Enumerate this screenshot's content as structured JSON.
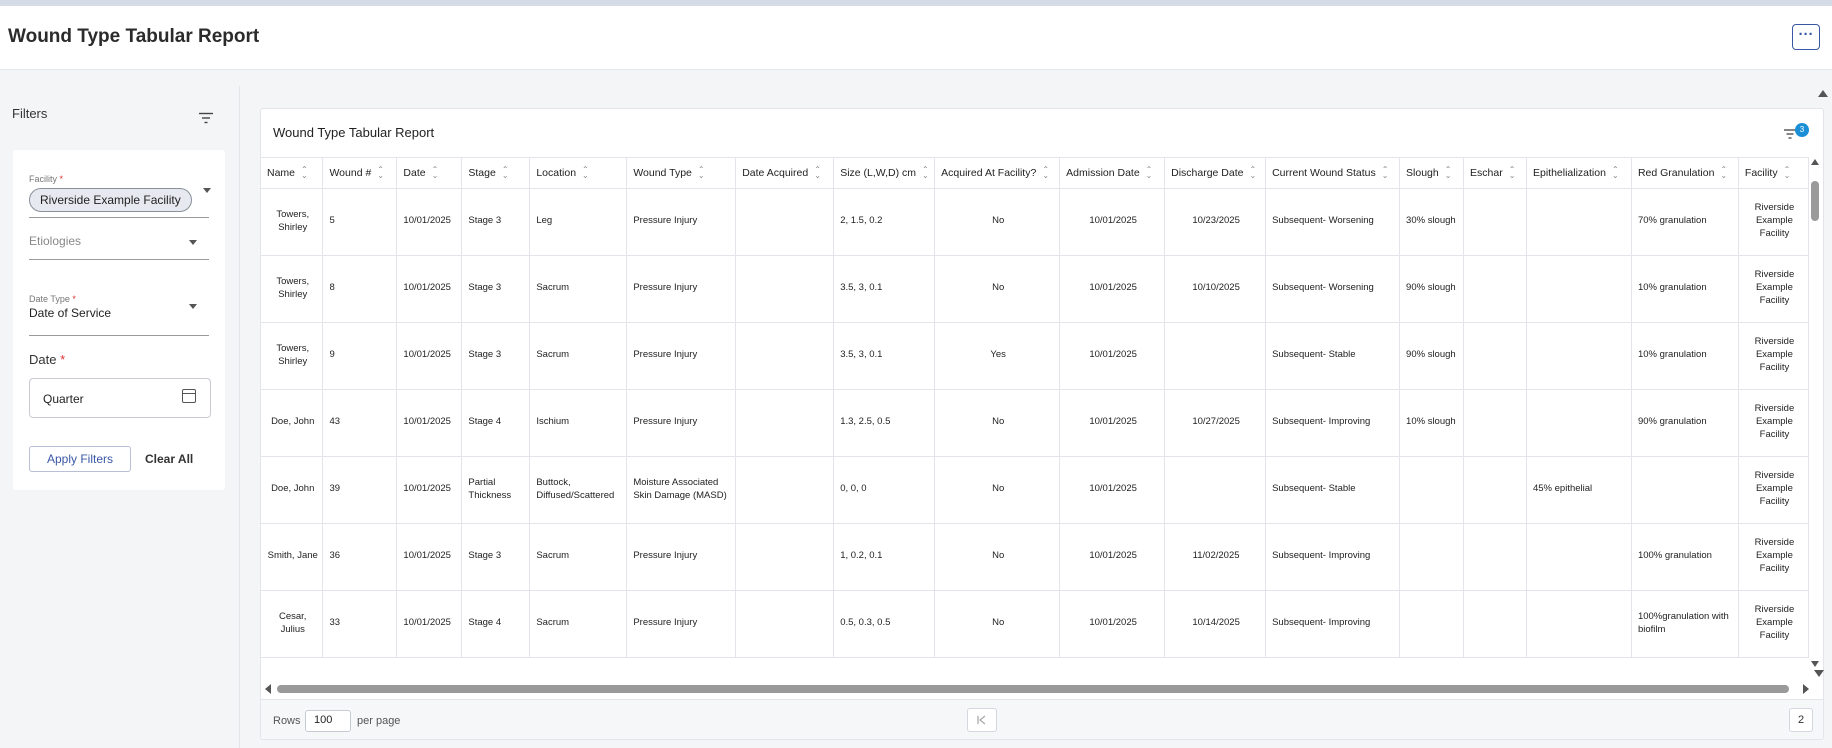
{
  "header": {
    "title": "Wound Type Tabular Report",
    "more_label": "···"
  },
  "sidebar": {
    "title": "Filters",
    "facility": {
      "label": "Facility",
      "required": "*",
      "value": "Riverside Example Facility"
    },
    "etiologies": {
      "placeholder": "Etiologies"
    },
    "date_type": {
      "label": "Date Type",
      "required": "*",
      "value": "Date of Service"
    },
    "date": {
      "label": "Date",
      "required": "*",
      "value": "Quarter"
    },
    "apply_label": "Apply Filters",
    "clear_label": "Clear All"
  },
  "report": {
    "title": "Wound Type Tabular Report",
    "filter_count": "3",
    "columns": [
      {
        "key": "name",
        "label": "Name"
      },
      {
        "key": "wound_no",
        "label": "Wound #"
      },
      {
        "key": "date",
        "label": "Date"
      },
      {
        "key": "stage",
        "label": "Stage"
      },
      {
        "key": "location",
        "label": "Location"
      },
      {
        "key": "wound_type",
        "label": "Wound Type"
      },
      {
        "key": "date_acquired",
        "label": "Date Acquired"
      },
      {
        "key": "size",
        "label": "Size (L,W,D) cm"
      },
      {
        "key": "acquired_at_facility",
        "label": "Acquired At Facility?"
      },
      {
        "key": "admission_date",
        "label": "Admission Date"
      },
      {
        "key": "discharge_date",
        "label": "Discharge Date"
      },
      {
        "key": "current_status",
        "label": "Current Wound Status"
      },
      {
        "key": "slough",
        "label": "Slough"
      },
      {
        "key": "eschar",
        "label": "Eschar"
      },
      {
        "key": "epithelialization",
        "label": "Epithelialization"
      },
      {
        "key": "red_granulation",
        "label": "Red Granulation"
      },
      {
        "key": "facility",
        "label": "Facility"
      }
    ],
    "rows": [
      {
        "name": "Towers, Shirley",
        "wound_no": "5",
        "date": "10/01/2025",
        "stage": "Stage 3",
        "location": "Leg",
        "wound_type": "Pressure Injury",
        "date_acquired": "",
        "size": "2, 1.5, 0.2",
        "acquired_at_facility": "No",
        "admission_date": "10/01/2025",
        "discharge_date": "10/23/2025",
        "current_status": "Subsequent- Worsening",
        "slough": "30% slough",
        "eschar": "",
        "epithelialization": "",
        "red_granulation": "70% granulation",
        "facility": "Riverside Example Facility"
      },
      {
        "name": "Towers, Shirley",
        "wound_no": "8",
        "date": "10/01/2025",
        "stage": "Stage 3",
        "location": "Sacrum",
        "wound_type": "Pressure Injury",
        "date_acquired": "",
        "size": "3.5, 3, 0.1",
        "acquired_at_facility": "No",
        "admission_date": "10/01/2025",
        "discharge_date": "10/10/2025",
        "current_status": "Subsequent- Worsening",
        "slough": "90% slough",
        "eschar": "",
        "epithelialization": "",
        "red_granulation": "10% granulation",
        "facility": "Riverside Example Facility"
      },
      {
        "name": "Towers, Shirley",
        "wound_no": "9",
        "date": "10/01/2025",
        "stage": "Stage 3",
        "location": "Sacrum",
        "wound_type": "Pressure Injury",
        "date_acquired": "",
        "size": "3.5, 3, 0.1",
        "acquired_at_facility": "Yes",
        "admission_date": "10/01/2025",
        "discharge_date": "",
        "current_status": "Subsequent- Stable",
        "slough": "90% slough",
        "eschar": "",
        "epithelialization": "",
        "red_granulation": "10% granulation",
        "facility": "Riverside Example Facility"
      },
      {
        "name": "Doe, John",
        "wound_no": "43",
        "date": "10/01/2025",
        "stage": "Stage 4",
        "location": "Ischium",
        "wound_type": "Pressure Injury",
        "date_acquired": "",
        "size": "1.3, 2.5, 0.5",
        "acquired_at_facility": "No",
        "admission_date": "10/01/2025",
        "discharge_date": "10/27/2025",
        "current_status": "Subsequent- Improving",
        "slough": "10% slough",
        "eschar": "",
        "epithelialization": "",
        "red_granulation": "90% granulation",
        "facility": "Riverside Example Facility"
      },
      {
        "name": "Doe, John",
        "wound_no": "39",
        "date": "10/01/2025",
        "stage": "Partial Thickness",
        "location": "Buttock, Diffused/Scattered",
        "wound_type": "Moisture Associated Skin Damage (MASD)",
        "date_acquired": "",
        "size": "0, 0, 0",
        "acquired_at_facility": "No",
        "admission_date": "10/01/2025",
        "discharge_date": "",
        "current_status": "Subsequent- Stable",
        "slough": "",
        "eschar": "",
        "epithelialization": "45% epithelial",
        "red_granulation": "",
        "facility": "Riverside Example Facility"
      },
      {
        "name": "Smith, Jane",
        "wound_no": "36",
        "date": "10/01/2025",
        "stage": "Stage 3",
        "location": "Sacrum",
        "wound_type": "Pressure Injury",
        "date_acquired": "",
        "size": "1, 0.2, 0.1",
        "acquired_at_facility": "No",
        "admission_date": "10/01/2025",
        "discharge_date": "11/02/2025",
        "current_status": "Subsequent- Improving",
        "slough": "",
        "eschar": "",
        "epithelialization": "",
        "red_granulation": "100% granulation",
        "facility": "Riverside Example Facility"
      },
      {
        "name": "Cesar, Julius",
        "wound_no": "33",
        "date": "10/01/2025",
        "stage": "Stage 4",
        "location": "Sacrum",
        "wound_type": "Pressure Injury",
        "date_acquired": "",
        "size": "0.5, 0.3, 0.5",
        "acquired_at_facility": "No",
        "admission_date": "10/01/2025",
        "discharge_date": "10/14/2025",
        "current_status": "Subsequent- Improving",
        "slough": "",
        "eschar": "",
        "epithelialization": "",
        "red_granulation": "100%granulation with biofilm",
        "facility": "Riverside Example Facility"
      }
    ]
  },
  "pagination": {
    "rows_label": "Rows",
    "rows_value": "100",
    "per_page_label": "per page",
    "first_page_icon": "first-page-icon",
    "current_page": "2"
  },
  "colors": {
    "accent": "#3a57a6",
    "badge": "#1a8fd6",
    "required": "#d33333"
  }
}
